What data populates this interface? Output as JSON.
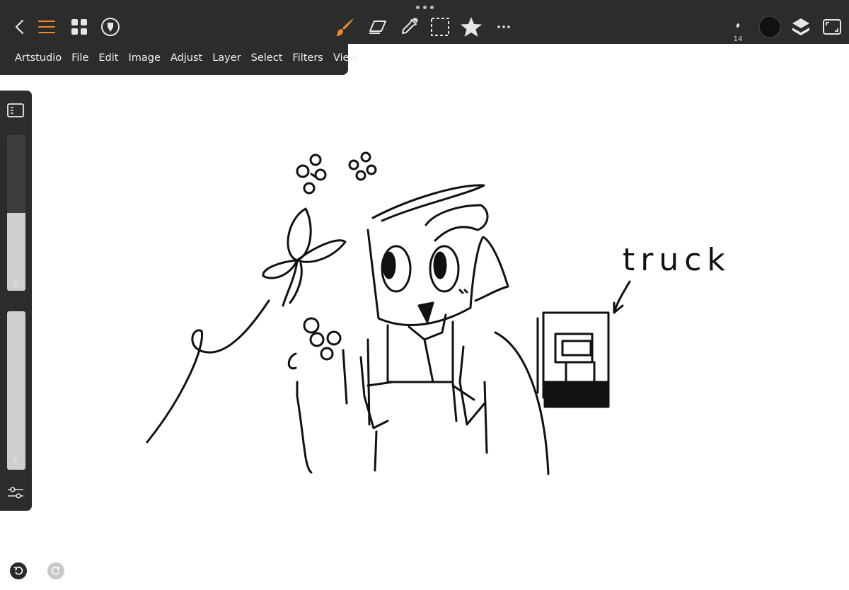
{
  "app": {
    "menu": [
      "Artstudio",
      "File",
      "Edit",
      "Image",
      "Adjust",
      "Layer",
      "Select",
      "Filters",
      "View"
    ]
  },
  "toolbar": {
    "brush_size": "14",
    "active_tool": "brush",
    "color": "#111111",
    "accent_color": "#e8892a"
  },
  "sidebar": {
    "size_slider": {
      "label": "S",
      "value": 0.5
    },
    "flow_slider": {
      "label": "F",
      "value": 1.0
    }
  },
  "canvas": {
    "annotation_text": "truck"
  },
  "icons": {
    "back": "chevron-left-icon",
    "menu": "hamburger-icon",
    "gallery": "grid-icon",
    "pen": "pen-nib-icon",
    "brush": "brush-icon",
    "eraser": "eraser-icon",
    "eyedropper": "eyedropper-icon",
    "selection": "selection-icon",
    "favorites": "star-icon",
    "more": "more-icon",
    "layers": "layers-icon",
    "fullscreen": "fullscreen-icon",
    "undo": "undo-icon",
    "redo": "redo-icon"
  }
}
